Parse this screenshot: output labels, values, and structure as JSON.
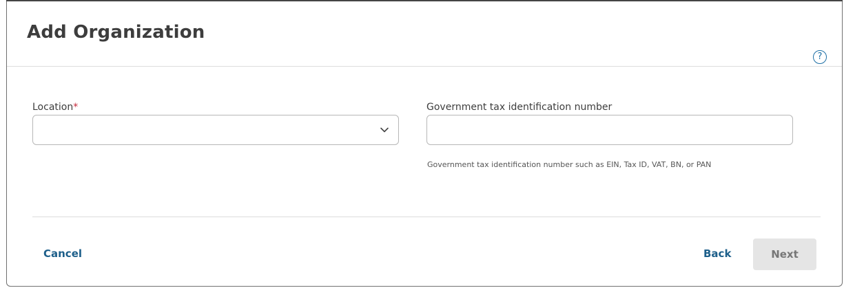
{
  "dialog": {
    "title": "Add Organization",
    "help_icon": "question-circle-icon",
    "help_glyph": "?"
  },
  "form": {
    "location": {
      "label": "Location",
      "required_marker": "*",
      "value": "",
      "dropdown_icon": "chevron-down-icon"
    },
    "tax_id": {
      "label": "Government tax identification number",
      "value": "",
      "help_text": "Government tax identification number such as EIN, Tax ID, VAT, BN, or PAN"
    }
  },
  "footer": {
    "cancel_label": "Cancel",
    "back_label": "Back",
    "next_label": "Next",
    "next_enabled": false
  },
  "colors": {
    "link": "#1d5f8a",
    "required": "#c6293b",
    "disabled_button_bg": "#e5e5e5"
  }
}
